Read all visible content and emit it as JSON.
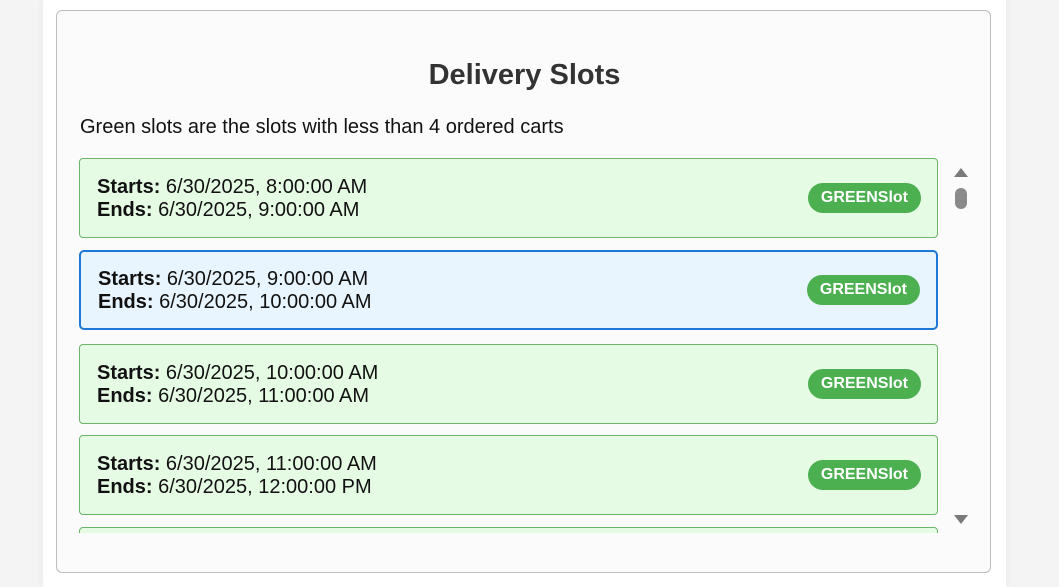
{
  "header": {
    "title": "Delivery Slots",
    "subtitle": "Green slots are the slots with less than 4 ordered carts"
  },
  "labels": {
    "starts": "Starts:",
    "ends": "Ends:"
  },
  "slots": [
    {
      "start": "6/30/2025, 8:00:00 AM",
      "end": "6/30/2025, 9:00:00 AM",
      "badge": "GREENSlot",
      "selected": false
    },
    {
      "start": "6/30/2025, 9:00:00 AM",
      "end": "6/30/2025, 10:00:00 AM",
      "badge": "GREENSlot",
      "selected": true
    },
    {
      "start": "6/30/2025, 10:00:00 AM",
      "end": "6/30/2025, 11:00:00 AM",
      "badge": "GREENSlot",
      "selected": false
    },
    {
      "start": "6/30/2025, 11:00:00 AM",
      "end": "6/30/2025, 12:00:00 PM",
      "badge": "GREENSlot",
      "selected": false
    }
  ],
  "colors": {
    "slot_bg": "#e6fbe4",
    "slot_border": "#6ab56a",
    "selected_bg": "#e8f4fe",
    "selected_border": "#1e78d6",
    "badge_bg": "#4caf50"
  }
}
